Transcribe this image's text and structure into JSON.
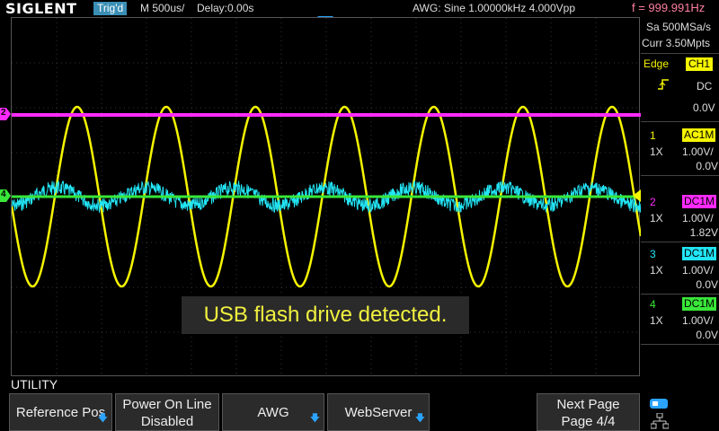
{
  "header": {
    "logo": "SIGLENT",
    "trigger_status": "Trig'd",
    "timebase": "M 500us/",
    "delay": "Delay:0.00s",
    "awg": "AWG: Sine  1.00000kHz  4.000Vpp",
    "frequency": "f = 999.991Hz"
  },
  "acquisition": {
    "sample_rate": "Sa 500MSa/s",
    "memory": "Curr 3.50Mpts"
  },
  "trigger": {
    "type": "Edge",
    "source": "CH1",
    "coupling": "DC",
    "level": "0.0V"
  },
  "channels": [
    {
      "num": "1",
      "coupling": "AC1M",
      "probe": "1X",
      "scale": "1.00V/",
      "offset": "0.0V",
      "color": "#f5f500"
    },
    {
      "num": "2",
      "coupling": "DC1M",
      "probe": "1X",
      "scale": "1.00V/",
      "offset": "1.82V",
      "color": "#ff2aff"
    },
    {
      "num": "3",
      "coupling": "DC1M",
      "probe": "1X",
      "scale": "1.00V/",
      "offset": "0.0V",
      "color": "#22e5f5"
    },
    {
      "num": "4",
      "coupling": "DC1M",
      "probe": "1X",
      "scale": "1.00V/",
      "offset": "0.0V",
      "color": "#39e639"
    }
  ],
  "markers": {
    "ch2": "2",
    "ch4": "4"
  },
  "message": "USB flash drive detected.",
  "menu": {
    "title": "UTILITY",
    "buttons": [
      {
        "line1": "Reference Pos",
        "line2": ""
      },
      {
        "line1": "Power On Line",
        "line2": "Disabled"
      },
      {
        "line1": "AWG",
        "line2": ""
      },
      {
        "line1": "WebServer",
        "line2": ""
      },
      {
        "line1": "Next Page",
        "line2": "Page 4/4"
      }
    ]
  },
  "icons": {
    "arrow": "chevron-down-icon",
    "usb": "usb-icon",
    "network": "network-icon"
  }
}
